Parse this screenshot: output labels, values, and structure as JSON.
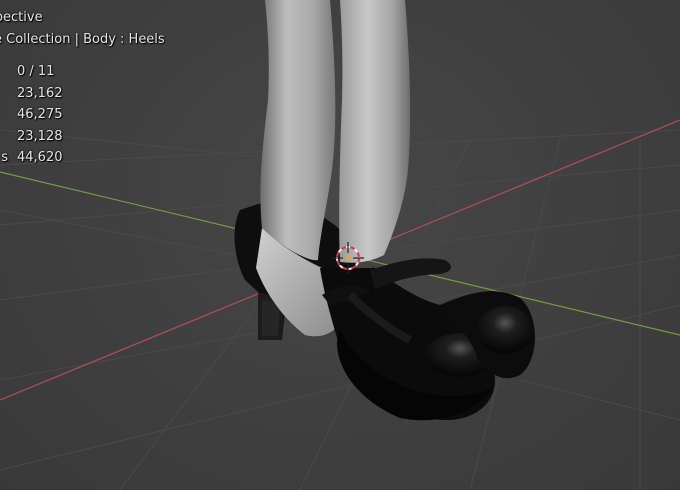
{
  "viewport": {
    "view_name": "spective",
    "collection_path": "e Collection | Body : Heels"
  },
  "stats": [
    {
      "label": "",
      "value": "0 / 11"
    },
    {
      "label": "",
      "value": "23,162"
    },
    {
      "label": "",
      "value": "46,275"
    },
    {
      "label": "",
      "value": "23,128"
    },
    {
      "label": "s",
      "value": "44,620"
    }
  ],
  "colors": {
    "background": "#3d3d3d",
    "grid_line": "#4a4a4a",
    "x_axis": "#b84a5f",
    "y_axis": "#7c9a3c",
    "cursor_red": "#d23a3a",
    "cursor_white": "#f2f2f2",
    "shoe": "#0d0d0d",
    "skin": "#b5b5b5"
  },
  "icons": {
    "cursor": "3d-cursor-icon"
  }
}
